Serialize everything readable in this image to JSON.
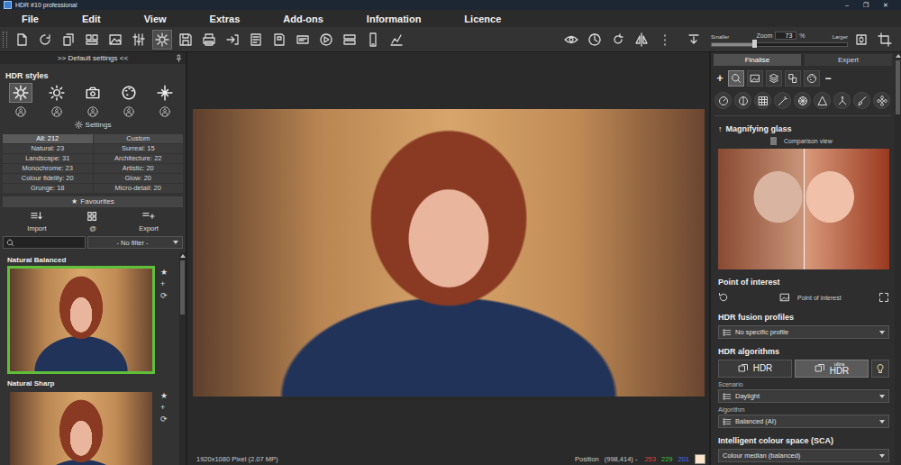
{
  "window": {
    "title": "HDR #10 professional",
    "controls": [
      "–",
      "❐",
      "✕"
    ]
  },
  "menu": [
    "File",
    "Edit",
    "View",
    "Extras",
    "Add-ons",
    "Information",
    "Licence"
  ],
  "toolbar": {
    "tools": [
      {
        "selected": false
      },
      {
        "selected": false
      },
      {
        "selected": false
      },
      {
        "selected": false
      },
      {
        "selected": false
      },
      {
        "selected": false
      },
      {
        "selected": true
      },
      {
        "selected": false
      },
      {
        "selected": false
      },
      {
        "selected": false
      },
      {
        "selected": false
      },
      {
        "selected": false
      },
      {
        "selected": false
      },
      {
        "selected": false
      },
      {
        "selected": false
      },
      {
        "selected": false
      },
      {
        "selected": false
      }
    ],
    "view_tools": [
      {
        "selected": false
      },
      {
        "selected": false
      },
      {
        "selected": false
      },
      {
        "selected": false
      },
      {
        "selected": false
      }
    ],
    "zoom": {
      "smaller": "Smaller",
      "label": "Zoom",
      "value": "73",
      "unit": "%",
      "larger": "Larger",
      "level": 0.3
    },
    "end_tools": [
      {
        "selected": false
      },
      {
        "selected": false
      }
    ]
  },
  "left_panel": {
    "header": ">> Default settings <<",
    "styles_title": "HDR styles",
    "styles": [
      {
        "selected": true
      },
      {
        "selected": false
      },
      {
        "selected": false
      },
      {
        "selected": false
      },
      {
        "selected": false
      }
    ],
    "settings": "Settings",
    "categories": [
      {
        "label": "All: 212",
        "selected": true
      },
      {
        "label": "Custom",
        "selected": false
      },
      {
        "label": "Natural: 23",
        "selected": false
      },
      {
        "label": "Surreal: 15",
        "selected": false
      },
      {
        "label": "Landscape: 31",
        "selected": false
      },
      {
        "label": "Architecture: 22",
        "selected": false
      },
      {
        "label": "Monochrome: 23",
        "selected": false
      },
      {
        "label": "Artistic: 20",
        "selected": false
      },
      {
        "label": "Colour fidelity: 20",
        "selected": false
      },
      {
        "label": "Glow: 20",
        "selected": false
      },
      {
        "label": "Grunge: 18",
        "selected": false
      },
      {
        "label": "Micro-detail: 20",
        "selected": false
      }
    ],
    "favourites": {
      "icon": "★",
      "label": "Favourites"
    },
    "transfer": [
      {
        "label": "Import"
      },
      {
        "label": "@"
      },
      {
        "label": "Export"
      }
    ],
    "search": {
      "value": "",
      "filter": "- No filter -"
    },
    "presets": [
      {
        "name": "Natural Balanced",
        "selected": true,
        "actions": [
          "★",
          "+",
          "⟳"
        ]
      },
      {
        "name": "Natural Sharp",
        "selected": false,
        "actions": [
          "★",
          "+",
          "⟳"
        ]
      }
    ]
  },
  "canvas": {
    "status": {
      "size": "1920x1080 Pixel (2.07 MP)",
      "position_label": "Position",
      "position": "(998,414) -",
      "channels": [
        {
          "value": "253",
          "color": "#e03c3c"
        },
        {
          "value": "229",
          "color": "#3cc43c"
        },
        {
          "value": "201",
          "color": "#4a6cf0"
        }
      ],
      "swatch": "#fde5c9"
    }
  },
  "right_panel": {
    "tabs": [
      {
        "label": "Finalise",
        "selected": true
      },
      {
        "label": "Expert",
        "selected": false
      }
    ],
    "add": "+",
    "remove": "−",
    "tools_top": [
      {
        "selected": true
      },
      {
        "selected": false
      },
      {
        "selected": false
      },
      {
        "selected": false
      },
      {
        "selected": false
      }
    ],
    "tools_bottom": [
      {
        "selected": false
      },
      {
        "selected": false
      },
      {
        "selected": false
      },
      {
        "selected": false
      },
      {
        "selected": false
      },
      {
        "selected": false
      },
      {
        "selected": false
      },
      {
        "selected": false
      },
      {
        "selected": false
      }
    ],
    "magnifier": {
      "icon": "↑",
      "title": "Magnifying glass",
      "comparison": {
        "label": "Comparison view",
        "on": false
      }
    },
    "point_of_interest": {
      "title": "Point of interest",
      "button": "Point of interest"
    },
    "fusion": {
      "title": "HDR fusion profiles",
      "value": "No specific profile"
    },
    "algorithms": {
      "title": "HDR algorithms",
      "modes": [
        {
          "prefix": "",
          "label": "HDR",
          "selected": false
        },
        {
          "prefix": "ultra",
          "label": "HDR",
          "selected": true
        }
      ],
      "fields": [
        {
          "label": "Scenario",
          "value": "Daylight"
        },
        {
          "label": "Algorithm",
          "value": "Balanced (AI)"
        }
      ]
    },
    "colour_space": {
      "title": "Intelligent colour space (SCA)",
      "value": "Colour median (balanced)"
    }
  }
}
